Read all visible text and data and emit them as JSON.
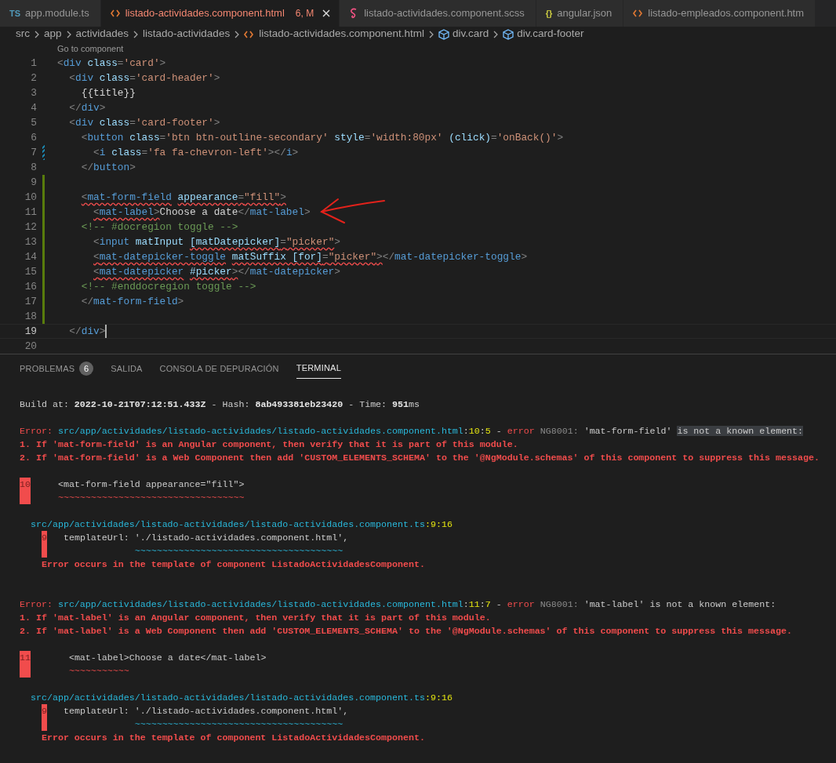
{
  "tabs": [
    {
      "kind": "ts",
      "icon_label": "TS",
      "label": "app.module.ts",
      "selected": false,
      "error": false
    },
    {
      "kind": "html",
      "label": "listado-actividades.component.html",
      "badge": "6, M",
      "selected": true,
      "error": true
    },
    {
      "kind": "scss",
      "label": "listado-actividades.component.scss",
      "selected": false,
      "error": false
    },
    {
      "kind": "json",
      "icon_label": "{}",
      "label": "angular.json",
      "selected": false,
      "error": false
    },
    {
      "kind": "html",
      "label": "listado-empleados.component.htm",
      "selected": false,
      "error": false
    }
  ],
  "breadcrumbs": [
    {
      "kind": "folder",
      "label": "src"
    },
    {
      "kind": "folder",
      "label": "app"
    },
    {
      "kind": "folder",
      "label": "actividades"
    },
    {
      "kind": "folder",
      "label": "listado-actividades"
    },
    {
      "kind": "html",
      "label": "listado-actividades.component.html"
    },
    {
      "kind": "element",
      "label": "div.card"
    },
    {
      "kind": "element",
      "label": "div.card-footer"
    }
  ],
  "editor": {
    "code_lens": "Go to component",
    "lines": [
      {
        "number": "1",
        "added": false,
        "modified": false,
        "current": false,
        "tokens": [
          {
            "kind": "punct",
            "text": "<",
            "error": false
          },
          {
            "kind": "tag",
            "text": "div",
            "error": false
          },
          {
            "kind": "attr",
            "text": " class",
            "error": false
          },
          {
            "kind": "punct",
            "text": "=",
            "error": false
          },
          {
            "kind": "str",
            "text": "'card'",
            "error": false
          },
          {
            "kind": "punct",
            "text": ">",
            "error": false
          }
        ]
      },
      {
        "number": "2",
        "added": false,
        "modified": false,
        "current": false,
        "tokens": [
          {
            "kind": "punct",
            "text": "  <",
            "error": false
          },
          {
            "kind": "tag",
            "text": "div",
            "error": false
          },
          {
            "kind": "attr",
            "text": " class",
            "error": false
          },
          {
            "kind": "punct",
            "text": "=",
            "error": false
          },
          {
            "kind": "str",
            "text": "'card-header'",
            "error": false
          },
          {
            "kind": "punct",
            "text": ">",
            "error": false
          }
        ]
      },
      {
        "number": "3",
        "added": false,
        "modified": false,
        "current": false,
        "tokens": [
          {
            "kind": "text",
            "text": "    {{title}}",
            "error": false
          }
        ]
      },
      {
        "number": "4",
        "added": false,
        "modified": false,
        "current": false,
        "tokens": [
          {
            "kind": "punct",
            "text": "  </",
            "error": false
          },
          {
            "kind": "tag",
            "text": "div",
            "error": false
          },
          {
            "kind": "punct",
            "text": ">",
            "error": false
          }
        ]
      },
      {
        "number": "5",
        "added": false,
        "modified": false,
        "current": false,
        "tokens": [
          {
            "kind": "punct",
            "text": "  <",
            "error": false
          },
          {
            "kind": "tag",
            "text": "div",
            "error": false
          },
          {
            "kind": "attr",
            "text": " class",
            "error": false
          },
          {
            "kind": "punct",
            "text": "=",
            "error": false
          },
          {
            "kind": "str",
            "text": "'card-footer'",
            "error": false
          },
          {
            "kind": "punct",
            "text": ">",
            "error": false
          }
        ]
      },
      {
        "number": "6",
        "added": false,
        "modified": false,
        "current": false,
        "tokens": [
          {
            "kind": "punct",
            "text": "    <",
            "error": false
          },
          {
            "kind": "tag",
            "text": "button",
            "error": false
          },
          {
            "kind": "attr",
            "text": " class",
            "error": false
          },
          {
            "kind": "punct",
            "text": "=",
            "error": false
          },
          {
            "kind": "str",
            "text": "'btn btn-outline-secondary'",
            "error": false
          },
          {
            "kind": "attr",
            "text": " style",
            "error": false
          },
          {
            "kind": "punct",
            "text": "=",
            "error": false
          },
          {
            "kind": "str",
            "text": "'width:80px'",
            "error": false
          },
          {
            "kind": "attr",
            "text": " (click)",
            "error": false
          },
          {
            "kind": "punct",
            "text": "=",
            "error": false
          },
          {
            "kind": "str",
            "text": "'onBack()'",
            "error": false
          },
          {
            "kind": "punct",
            "text": ">",
            "error": false
          }
        ]
      },
      {
        "number": "7",
        "added": false,
        "modified": true,
        "current": false,
        "tokens": [
          {
            "kind": "punct",
            "text": "      <",
            "error": false
          },
          {
            "kind": "tag",
            "text": "i",
            "error": false
          },
          {
            "kind": "attr",
            "text": " class",
            "error": false
          },
          {
            "kind": "punct",
            "text": "=",
            "error": false
          },
          {
            "kind": "str",
            "text": "'fa fa-chevron-left'",
            "error": false
          },
          {
            "kind": "punct",
            "text": "></",
            "error": false
          },
          {
            "kind": "tag",
            "text": "i",
            "error": false
          },
          {
            "kind": "punct",
            "text": ">",
            "error": false
          }
        ]
      },
      {
        "number": "8",
        "added": false,
        "modified": false,
        "current": false,
        "tokens": [
          {
            "kind": "punct",
            "text": "    </",
            "error": false
          },
          {
            "kind": "tag",
            "text": "button",
            "error": false
          },
          {
            "kind": "punct",
            "text": ">",
            "error": false
          }
        ]
      },
      {
        "number": "9",
        "added": true,
        "modified": false,
        "current": false
      },
      {
        "number": "10",
        "added": true,
        "modified": false,
        "current": false,
        "tokens": [
          {
            "kind": "punct",
            "text": "    <",
            "error": true
          },
          {
            "kind": "tag",
            "text": "mat-form-field",
            "error": true
          },
          {
            "kind": "attr",
            "text": " appearance",
            "error": true
          },
          {
            "kind": "punct",
            "text": "=",
            "error": true
          },
          {
            "kind": "str",
            "text": "\"fill\"",
            "error": true
          },
          {
            "kind": "punct",
            "text": ">",
            "error": true
          }
        ]
      },
      {
        "number": "11",
        "added": true,
        "modified": false,
        "current": false,
        "tokens": [
          {
            "kind": "punct",
            "text": "      <",
            "error": true
          },
          {
            "kind": "tag",
            "text": "mat-label",
            "error": true
          },
          {
            "kind": "punct",
            "text": ">",
            "error": true
          },
          {
            "kind": "text",
            "text": "Choose a date",
            "error": false
          },
          {
            "kind": "punct",
            "text": "</",
            "error": false
          },
          {
            "kind": "tag",
            "text": "mat-label",
            "error": false
          },
          {
            "kind": "punct",
            "text": ">",
            "error": false
          }
        ]
      },
      {
        "number": "12",
        "added": true,
        "modified": false,
        "current": false,
        "tokens": [
          {
            "kind": "comment",
            "text": "    <!-- #docregion toggle -->",
            "error": false
          }
        ]
      },
      {
        "number": "13",
        "added": true,
        "modified": false,
        "current": false,
        "tokens": [
          {
            "kind": "punct",
            "text": "      <",
            "error": false
          },
          {
            "kind": "tag",
            "text": "input",
            "error": false
          },
          {
            "kind": "attr",
            "text": " matInput ",
            "error": false
          },
          {
            "kind": "attr",
            "text": "[matDatepicker]",
            "error": true
          },
          {
            "kind": "punct",
            "text": "=",
            "error": true
          },
          {
            "kind": "str",
            "text": "\"picker\"",
            "error": true
          },
          {
            "kind": "punct",
            "text": ">",
            "error": false
          }
        ]
      },
      {
        "number": "14",
        "added": true,
        "modified": false,
        "current": false,
        "tokens": [
          {
            "kind": "punct",
            "text": "      <",
            "error": true
          },
          {
            "kind": "tag",
            "text": "mat-datepicker-toggle",
            "error": true
          },
          {
            "kind": "attr",
            "text": " matSuffix [for]",
            "error": true
          },
          {
            "kind": "punct",
            "text": "=",
            "error": true
          },
          {
            "kind": "str",
            "text": "\"picker\"",
            "error": true
          },
          {
            "kind": "punct",
            "text": ">",
            "error": true
          },
          {
            "kind": "punct",
            "text": "</",
            "error": false
          },
          {
            "kind": "tag",
            "text": "mat-datepicker-toggle",
            "error": false
          },
          {
            "kind": "punct",
            "text": ">",
            "error": false
          }
        ]
      },
      {
        "number": "15",
        "added": true,
        "modified": false,
        "current": false,
        "tokens": [
          {
            "kind": "punct",
            "text": "      <",
            "error": true
          },
          {
            "kind": "tag",
            "text": "mat-datepicker",
            "error": true
          },
          {
            "kind": "attr",
            "text": " #picker",
            "error": true
          },
          {
            "kind": "punct",
            "text": ">",
            "error": true
          },
          {
            "kind": "punct",
            "text": "</",
            "error": false
          },
          {
            "kind": "tag",
            "text": "mat-datepicker",
            "error": false
          },
          {
            "kind": "punct",
            "text": ">",
            "error": false
          }
        ]
      },
      {
        "number": "16",
        "added": true,
        "modified": false,
        "current": false,
        "tokens": [
          {
            "kind": "comment",
            "text": "    <!-- #enddocregion toggle -->",
            "error": false
          }
        ]
      },
      {
        "number": "17",
        "added": true,
        "modified": false,
        "current": false,
        "tokens": [
          {
            "kind": "punct",
            "text": "    </",
            "error": false
          },
          {
            "kind": "tag",
            "text": "mat-form-field",
            "error": false
          },
          {
            "kind": "punct",
            "text": ">",
            "error": false
          }
        ]
      },
      {
        "number": "18",
        "added": true,
        "modified": false,
        "current": false
      },
      {
        "number": "19",
        "added": false,
        "modified": false,
        "current": true,
        "tokens": [
          {
            "kind": "punct",
            "text": "  </",
            "error": false
          },
          {
            "kind": "tag",
            "text": "div",
            "error": false
          },
          {
            "kind": "punct",
            "text": ">",
            "error": false
          }
        ]
      },
      {
        "number": "20",
        "added": false,
        "modified": false,
        "current": false
      }
    ]
  },
  "panel": {
    "tabs": [
      {
        "label": "PROBLEMAS",
        "count": "6",
        "selected": false
      },
      {
        "label": "SALIDA",
        "selected": false
      },
      {
        "label": "CONSOLA DE DEPURACIÓN",
        "selected": false
      },
      {
        "label": "TERMINAL",
        "selected": true
      }
    ],
    "terminal": {
      "sections": [
        {
          "blocks": [
            [
              {
                "segments": [
                  {
                    "kind": "plain",
                    "text": "Build at: "
                  },
                  {
                    "kind": "bold",
                    "text": "2022-10-21T07:12:51.433Z"
                  },
                  {
                    "kind": "plain",
                    "text": " - Hash: "
                  },
                  {
                    "kind": "bold",
                    "text": "8ab493381eb23420"
                  },
                  {
                    "kind": "plain",
                    "text": " - Time: "
                  },
                  {
                    "kind": "bold",
                    "text": "951"
                  },
                  {
                    "kind": "plain",
                    "text": "ms"
                  }
                ]
              }
            ],
            [
              {
                "segments": [
                  {
                    "kind": "error",
                    "text": "Error: "
                  },
                  {
                    "kind": "path",
                    "text": "src/app/actividades/listado-actividades/listado-actividades.component.html"
                  },
                  {
                    "kind": "plain",
                    "text": ":"
                  },
                  {
                    "kind": "num",
                    "text": "10"
                  },
                  {
                    "kind": "plain",
                    "text": ":"
                  },
                  {
                    "kind": "num",
                    "text": "5"
                  },
                  {
                    "kind": "plain",
                    "text": " - "
                  },
                  {
                    "kind": "error",
                    "text": "error"
                  },
                  {
                    "kind": "muted",
                    "text": " NG8001: "
                  },
                  {
                    "kind": "plain",
                    "text": "'mat-form-field' "
                  },
                  {
                    "kind": "highlight",
                    "text": "is not a known element:"
                  }
                ]
              },
              {
                "segments": [
                  {
                    "kind": "error_bold",
                    "text": "1. If 'mat-form-field' is an Angular component, then verify that it is part of this module."
                  }
                ]
              },
              {
                "segments": [
                  {
                    "kind": "error_bold",
                    "text": "2. If 'mat-form-field' is a Web Component then add 'CUSTOM_ELEMENTS_SCHEMA' to the '@NgModule.schemas' of this component to suppress this message."
                  }
                ]
              }
            ],
            [
              {
                "segments": [
                  {
                    "kind": "marker",
                    "text": "10"
                  },
                  {
                    "kind": "plain",
                    "text": "     <mat-form-field appearance=\"fill\">"
                  }
                ]
              },
              {
                "segments": [
                  {
                    "kind": "squiggle_error",
                    "text": "       ~~~~~~~~~~~~~~~~~~~~~~~~~~~~~~~~~~"
                  }
                ]
              }
            ],
            [
              {
                "segments": [
                  {
                    "kind": "path",
                    "text": "  src/app/actividades/listado-actividades/listado-actividades.component.ts"
                  },
                  {
                    "kind": "num",
                    "text": ":9:16"
                  }
                ]
              },
              {
                "segments": [
                  {
                    "kind": "marker",
                    "text": "    9"
                  },
                  {
                    "kind": "plain",
                    "text": "   templateUrl: './listado-actividades.component.html',"
                  }
                ]
              },
              {
                "segments": [
                  {
                    "kind": "squiggle_info",
                    "text": "                     ~~~~~~~~~~~~~~~~~~~~~~~~~~~~~~~~~~~~~~"
                  }
                ]
              },
              {
                "segments": [
                  {
                    "kind": "error_bold",
                    "text": "    Error occurs in the template of component ListadoActividadesComponent."
                  }
                ]
              }
            ]
          ]
        },
        {
          "blocks": [
            [
              {
                "segments": [
                  {
                    "kind": "error",
                    "text": "Error: "
                  },
                  {
                    "kind": "path",
                    "text": "src/app/actividades/listado-actividades/listado-actividades.component.html"
                  },
                  {
                    "kind": "plain",
                    "text": ":"
                  },
                  {
                    "kind": "num",
                    "text": "11"
                  },
                  {
                    "kind": "plain",
                    "text": ":"
                  },
                  {
                    "kind": "num",
                    "text": "7"
                  },
                  {
                    "kind": "plain",
                    "text": " - "
                  },
                  {
                    "kind": "error",
                    "text": "error"
                  },
                  {
                    "kind": "muted",
                    "text": " NG8001: "
                  },
                  {
                    "kind": "plain",
                    "text": "'mat-label' is not a known element:"
                  }
                ]
              },
              {
                "segments": [
                  {
                    "kind": "error_bold",
                    "text": "1. If 'mat-label' is an Angular component, then verify that it is part of this module."
                  }
                ]
              },
              {
                "segments": [
                  {
                    "kind": "error_bold",
                    "text": "2. If 'mat-label' is a Web Component then add 'CUSTOM_ELEMENTS_SCHEMA' to the '@NgModule.schemas' of this component to suppress this message."
                  }
                ]
              }
            ],
            [
              {
                "segments": [
                  {
                    "kind": "marker",
                    "text": "11"
                  },
                  {
                    "kind": "plain",
                    "text": "       <mat-label>Choose a date</mat-label>"
                  }
                ]
              },
              {
                "segments": [
                  {
                    "kind": "squiggle_error",
                    "text": "         ~~~~~~~~~~~"
                  }
                ]
              }
            ],
            [
              {
                "segments": [
                  {
                    "kind": "path",
                    "text": "  src/app/actividades/listado-actividades/listado-actividades.component.ts"
                  },
                  {
                    "kind": "num",
                    "text": ":9:16"
                  }
                ]
              },
              {
                "segments": [
                  {
                    "kind": "marker",
                    "text": "    9"
                  },
                  {
                    "kind": "plain",
                    "text": "   templateUrl: './listado-actividades.component.html',"
                  }
                ]
              },
              {
                "segments": [
                  {
                    "kind": "squiggle_info",
                    "text": "                     ~~~~~~~~~~~~~~~~~~~~~~~~~~~~~~~~~~~~~~"
                  }
                ]
              },
              {
                "segments": [
                  {
                    "kind": "error_bold",
                    "text": "    Error occurs in the template of component ListadoActividadesComponent."
                  }
                ]
              }
            ]
          ]
        }
      ]
    }
  }
}
